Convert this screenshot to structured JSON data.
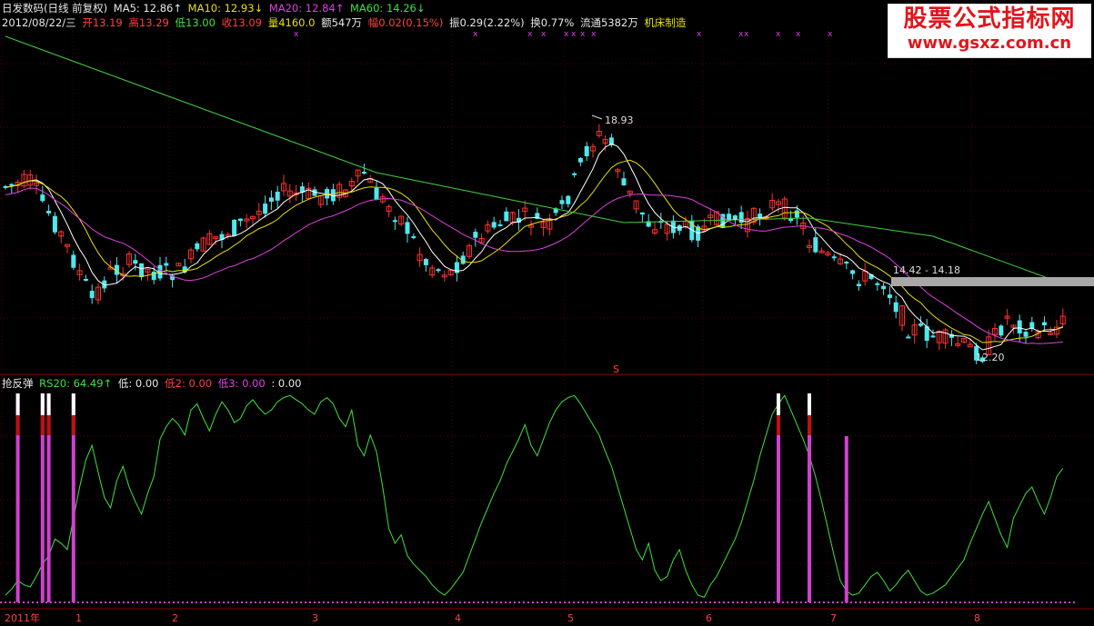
{
  "header": {
    "stock_title": "日发数码(日线 前复权)",
    "ma5": "MA5: 12.86↑",
    "ma10": "MA10: 12.93↓",
    "ma20": "MA20: 12.84↑",
    "ma60": "MA60: 14.26↓",
    "date": "2012/08/22/三",
    "open": "开13.19",
    "high": "高13.29",
    "low": "低13.00",
    "close": "收13.09",
    "volume": "量4160.0",
    "amount": "额547万",
    "change": "幅0.02(0.15%)",
    "amplitude": "振0.29(2.22%)",
    "turnover": "换0.77%",
    "float": "流通5382万",
    "sector": "机床制造"
  },
  "indicator": {
    "name": "抢反弹",
    "rs20": "RS20: 64.49↑",
    "low1": "低: 0.00",
    "low2": "低2: 0.00",
    "low3": "低3: 0.00",
    "extra": ": 0.00"
  },
  "watermark": {
    "line1": "股票公式指标网",
    "line2": "www.gsxz.com.cn"
  },
  "colors": {
    "up": "#ff3030",
    "down": "#4ee8ee",
    "ma5": "#ffffff",
    "ma10": "#e8e000",
    "ma20": "#e040e0",
    "ma60": "#40d040",
    "rs": "#40e040",
    "signal": "#d040d0",
    "grid": "#8b0000",
    "text": "#d0d0d0"
  },
  "chart_data": {
    "type": "candlestick",
    "price_annotations": {
      "high": "18.93",
      "low": "12.20",
      "range": "14.42 - 14.18"
    },
    "ma_values": {
      "ma5": 12.86,
      "ma10": 12.93,
      "ma20": 12.84,
      "ma60": 14.26
    },
    "x_ticks": [
      "2011年",
      "1",
      "2",
      "3",
      "4",
      "5",
      "6",
      "7",
      "8"
    ],
    "marker_symbol": "x",
    "dividend_symbol": "S",
    "indicator_panel": {
      "type": "line",
      "series_name": "RS20",
      "last_value": 64.49,
      "values": [
        3,
        6,
        10,
        8,
        7,
        12,
        18,
        22,
        30,
        28,
        25,
        40,
        55,
        68,
        75,
        62,
        50,
        45,
        58,
        65,
        55,
        48,
        42,
        52,
        60,
        78,
        84,
        88,
        85,
        80,
        92,
        95,
        88,
        82,
        90,
        96,
        92,
        86,
        88,
        94,
        97,
        93,
        90,
        92,
        96,
        98,
        99,
        97,
        95,
        92,
        90,
        96,
        98,
        95,
        88,
        84,
        92,
        75,
        70,
        80,
        72,
        55,
        35,
        28,
        32,
        22,
        18,
        15,
        12,
        8,
        5,
        3,
        6,
        10,
        14,
        22,
        30,
        38,
        45,
        52,
        58,
        66,
        72,
        78,
        85,
        75,
        70,
        78,
        86,
        92,
        96,
        98,
        99,
        95,
        90,
        85,
        80,
        72,
        65,
        55,
        45,
        35,
        25,
        20,
        28,
        15,
        10,
        12,
        20,
        25,
        15,
        8,
        3,
        2,
        8,
        12,
        18,
        24,
        30,
        38,
        48,
        58,
        70,
        80,
        90,
        95,
        99,
        92,
        85,
        78,
        70,
        60,
        48,
        35,
        22,
        10,
        5,
        3,
        4,
        8,
        12,
        14,
        10,
        5,
        8,
        12,
        15,
        10,
        5,
        3,
        4,
        6,
        8,
        12,
        16,
        20,
        28,
        35,
        42,
        48,
        40,
        32,
        26,
        40,
        46,
        52,
        55,
        48,
        42,
        50,
        60,
        64
      ]
    },
    "signals": [
      2,
      6,
      7,
      11,
      125,
      130,
      136
    ]
  }
}
